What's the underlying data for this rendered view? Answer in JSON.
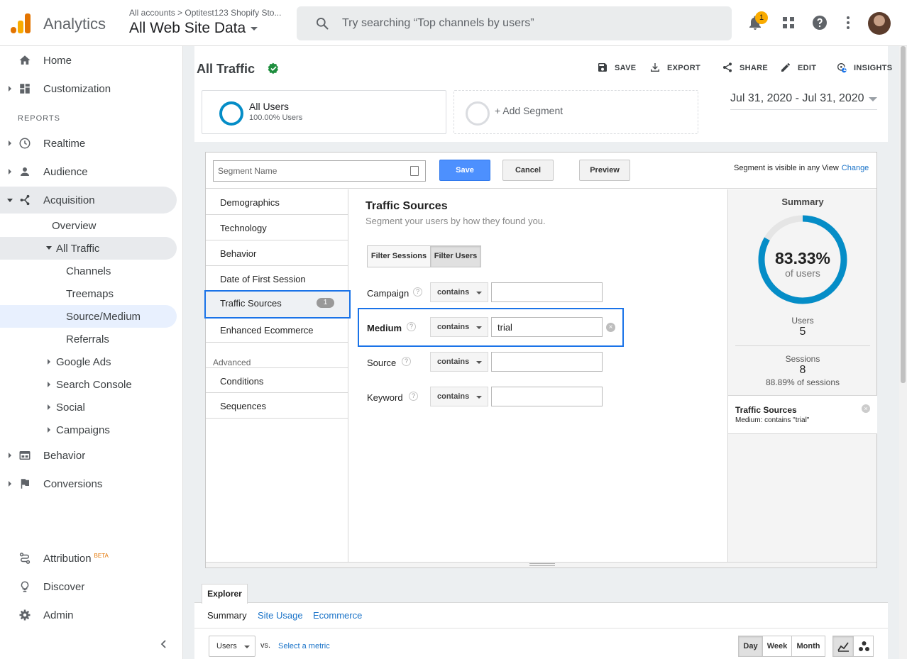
{
  "header": {
    "brand": "Analytics",
    "account_crumb": "All accounts > Optitest123 Shopify Sto...",
    "view_name": "All Web Site Data",
    "search_placeholder": "Try searching “Top channels by users”",
    "notification_count": "1"
  },
  "sidebar": {
    "home": "Home",
    "customization": "Customization",
    "reports_header": "REPORTS",
    "realtime": "Realtime",
    "audience": "Audience",
    "acquisition": "Acquisition",
    "overview": "Overview",
    "all_traffic": "All Traffic",
    "channels": "Channels",
    "treemaps": "Treemaps",
    "source_medium": "Source/Medium",
    "referrals": "Referrals",
    "google_ads": "Google Ads",
    "search_console": "Search Console",
    "social": "Social",
    "campaigns": "Campaigns",
    "behavior": "Behavior",
    "conversions": "Conversions",
    "attribution": "Attribution",
    "attribution_badge": "BETA",
    "discover": "Discover",
    "admin": "Admin"
  },
  "page": {
    "title": "All Traffic",
    "actions": {
      "save": "SAVE",
      "export": "EXPORT",
      "share": "SHARE",
      "edit": "EDIT",
      "insights": "INSIGHTS",
      "insights_count": "1"
    },
    "segments": [
      {
        "name": "All Users",
        "detail": "100.00% Users"
      }
    ],
    "add_segment": "+ Add Segment",
    "date_range": "Jul 31, 2020 - Jul 31, 2020"
  },
  "segment_editor": {
    "name_placeholder": "Segment Name",
    "save_label": "Save",
    "cancel_label": "Cancel",
    "preview_label": "Preview",
    "visibility_text": "Segment is visible in any View",
    "change_link": "Change",
    "categories": {
      "demographics": "Demographics",
      "technology": "Technology",
      "behavior": "Behavior",
      "date_first_session": "Date of First Session",
      "traffic_sources": "Traffic Sources",
      "traffic_sources_count": "1",
      "enhanced_ecommerce": "Enhanced Ecommerce",
      "advanced_label": "Advanced",
      "conditions": "Conditions",
      "sequences": "Sequences"
    },
    "panel": {
      "title": "Traffic Sources",
      "subtitle": "Segment your users by how they found you.",
      "filter_sessions": "Filter Sessions",
      "filter_users": "Filter Users",
      "help_glyph": "?",
      "clear_glyph": "×",
      "rows": [
        {
          "label": "Campaign",
          "operator": "contains",
          "value": ""
        },
        {
          "label": "Medium",
          "operator": "contains",
          "value": "trial"
        },
        {
          "label": "Source",
          "operator": "contains",
          "value": ""
        },
        {
          "label": "Keyword",
          "operator": "contains",
          "value": ""
        }
      ]
    },
    "summary": {
      "title": "Summary",
      "percent": "83.33%",
      "percent_value": 83.33,
      "percent_label": "of users",
      "users_label": "Users",
      "users_value": "5",
      "sessions_label": "Sessions",
      "sessions_value": "8",
      "sessions_pct": "88.89% of sessions",
      "card_title": "Traffic Sources",
      "card_desc": "Medium: contains \"trial\"",
      "ring_color": "#058dc7"
    }
  },
  "explorer": {
    "tab": "Explorer",
    "links": {
      "summary": "Summary",
      "site_usage": "Site Usage",
      "ecommerce": "Ecommerce"
    },
    "primary_metric": "Users",
    "vs": "vs.",
    "select_metric": "Select a metric",
    "periods": {
      "day": "Day",
      "week": "Week",
      "month": "Month"
    }
  }
}
